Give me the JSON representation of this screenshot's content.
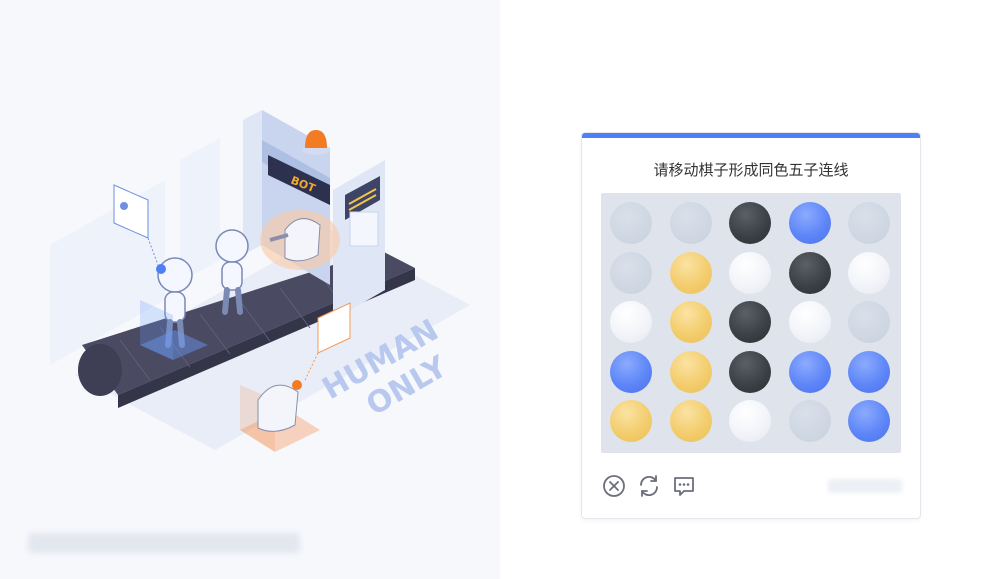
{
  "illustration": {
    "sign_text": "BOT",
    "slogan_line1": "HUMAN",
    "slogan_line2": "ONLY"
  },
  "captcha": {
    "title": "请移动棋子形成同色五子连线",
    "board": [
      [
        "empty",
        "empty",
        "black",
        "blue",
        "empty"
      ],
      [
        "empty",
        "yellow",
        "white",
        "black",
        "white"
      ],
      [
        "white",
        "yellow",
        "black",
        "white",
        "empty"
      ],
      [
        "blue",
        "yellow",
        "black",
        "blue",
        "blue"
      ],
      [
        "yellow",
        "yellow",
        "white",
        "empty",
        "blue"
      ]
    ],
    "controls": {
      "close_icon": "close-circle-icon",
      "refresh_icon": "refresh-icon",
      "feedback_icon": "feedback-chat-icon"
    }
  },
  "colors": {
    "accent": "#4e7ff5",
    "blue_piece": "#5e86f7",
    "yellow_piece": "#f3cd6d",
    "black_piece": "#3c4147",
    "white_piece": "#f2f4f9",
    "empty_slot": "#cdd5e1"
  }
}
